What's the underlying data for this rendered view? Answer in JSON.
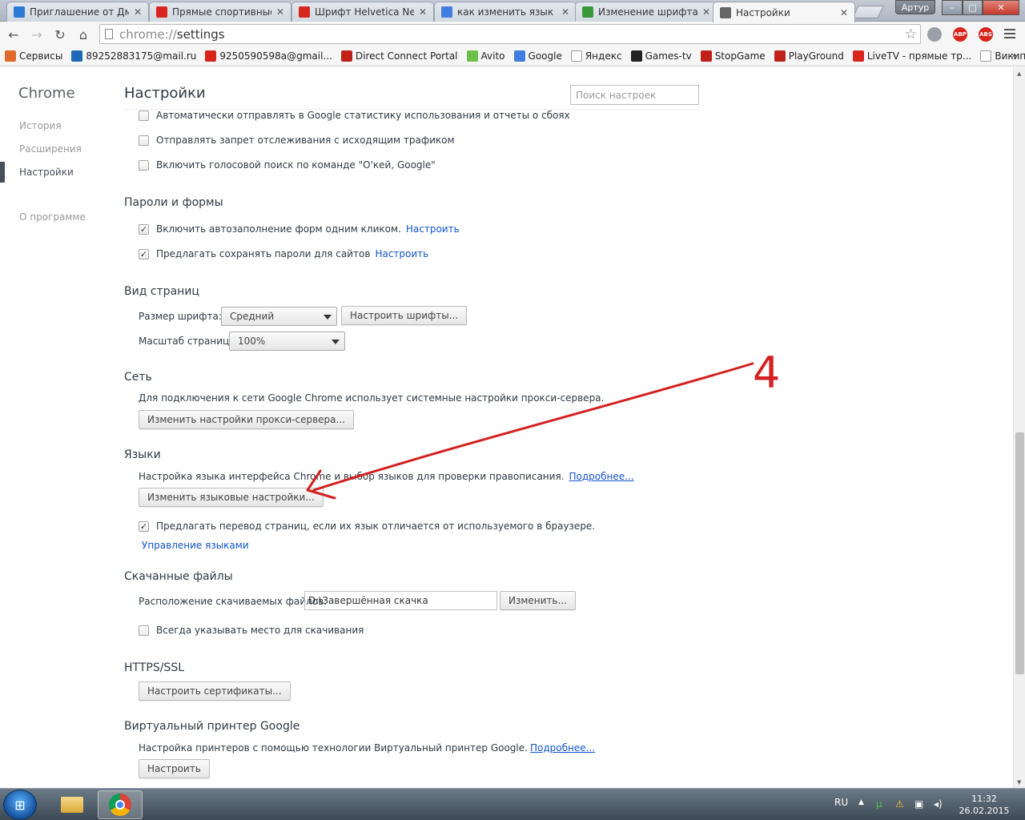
{
  "tabs": [
    {
      "title": "Приглашение от Дми",
      "favicon_color": "#2b7bd4",
      "active": false
    },
    {
      "title": "Прямые спортивные",
      "favicon_color": "#d8261d",
      "active": false
    },
    {
      "title": "Шрифт Helvetica Neue",
      "favicon_color": "#d8261d",
      "active": false
    },
    {
      "title": "как изменить язык гу",
      "favicon_color": "#3f7de0",
      "active": false
    },
    {
      "title": "Изменение шрифта, н",
      "favicon_color": "#3a9a3a",
      "active": false
    },
    {
      "title": "Настройки",
      "favicon_color": "#666666",
      "active": true
    }
  ],
  "window": {
    "profile_name": "Артур",
    "minimize_glyph": "–",
    "maximize_glyph": "□",
    "close_glyph": "✕"
  },
  "toolbar": {
    "url_scheme": "chrome://",
    "url_path": "settings",
    "extensions": [
      {
        "name": "extension-icon",
        "label": "",
        "color": "#9aa0a6"
      },
      {
        "name": "adblock-plus-icon",
        "label": "ABP",
        "color": "#d8261d"
      },
      {
        "name": "adblock-icon",
        "label": "ABS",
        "color": "#d8261d"
      }
    ]
  },
  "bookmarks": [
    {
      "label": "Сервисы",
      "icon": "apps-icon",
      "color": "#e06a2c"
    },
    {
      "label": "89252883175@mail.ru",
      "icon": "mail-ru-icon",
      "color": "#1e6ab5"
    },
    {
      "label": "9250590598a@gmail...",
      "icon": "gmail-icon",
      "color": "#d8261d"
    },
    {
      "label": "Direct Connect Portal",
      "icon": "direct-connect-icon",
      "color": "#c0221b"
    },
    {
      "label": "Avito",
      "icon": "avito-icon",
      "color": "#6cc04a"
    },
    {
      "label": "Google",
      "icon": "google-icon",
      "color": "#3f7de0"
    },
    {
      "label": "Яндекс",
      "icon": "yandex-icon",
      "color": "#ffffff"
    },
    {
      "label": "Games-tv",
      "icon": "games-tv-icon",
      "color": "#222222"
    },
    {
      "label": "StopGame",
      "icon": "stopgame-icon",
      "color": "#c0221b"
    },
    {
      "label": "PlayGround",
      "icon": "playground-icon",
      "color": "#c0221b"
    },
    {
      "label": "LiveTV - прямые тр...",
      "icon": "livetv-icon",
      "color": "#d8261d"
    },
    {
      "label": "Википедия",
      "icon": "wikipedia-icon",
      "color": "#ffffff"
    }
  ],
  "sidebar": {
    "title": "Chrome",
    "items": [
      {
        "label": "История"
      },
      {
        "label": "Расширения"
      },
      {
        "label": "Настройки"
      },
      {
        "label": "О программе"
      }
    ]
  },
  "settings": {
    "title": "Настройки",
    "search_placeholder": "Поиск настроек",
    "privacy": {
      "usage_stats": "Автоматически отправлять в Google статистику использования и отчеты о сбоях",
      "do_not_track": "Отправлять запрет отслеживания с исходящим трафиком",
      "voice_search": "Включить голосовой поиск по команде \"О'кей, Google\""
    },
    "passwords": {
      "title": "Пароли и формы",
      "autofill": "Включить автозаполнение форм одним кликом.",
      "autofill_link": "Настроить",
      "save_passwords": "Предлагать сохранять пароли для сайтов",
      "save_passwords_link": "Настроить"
    },
    "web_content": {
      "title": "Вид страниц",
      "font_size_label": "Размер шрифта:",
      "font_size_value": "Средний",
      "customize_fonts": "Настроить шрифты...",
      "zoom_label": "Масштаб страницы:",
      "zoom_value": "100%"
    },
    "network": {
      "title": "Сеть",
      "description": "Для подключения к сети Google Chrome использует системные настройки прокси-сервера.",
      "proxy_button": "Изменить настройки прокси-сервера..."
    },
    "languages": {
      "title": "Языки",
      "description": "Настройка языка интерфейса Chrome и выбор языков для проверки правописания.",
      "learn_more": "Подробнее...",
      "language_button": "Изменить языковые настройки...",
      "translate": "Предлагать перевод страниц, если их язык отличается от используемого в браузере.",
      "manage_languages": "Управление языками"
    },
    "downloads": {
      "title": "Скачанные файлы",
      "location_label": "Расположение скачиваемых файлов:",
      "location_value": "D:\\Завершённая скачка",
      "change_button": "Изменить...",
      "ask_location": "Всегда указывать место для скачивания"
    },
    "https": {
      "title": "HTTPS/SSL",
      "certificates_button": "Настроить сертификаты..."
    },
    "cloud_print": {
      "title": "Виртуальный принтер Google",
      "description": "Настройка принтеров с помощью технологии Виртуальный принтер Google.",
      "learn_more": "Подробнее...",
      "configure_button": "Настроить"
    }
  },
  "annotation": {
    "number": "4",
    "color": "#d42020"
  },
  "taskbar": {
    "language": "RU",
    "time": "11:32",
    "date": "26.02.2015"
  }
}
